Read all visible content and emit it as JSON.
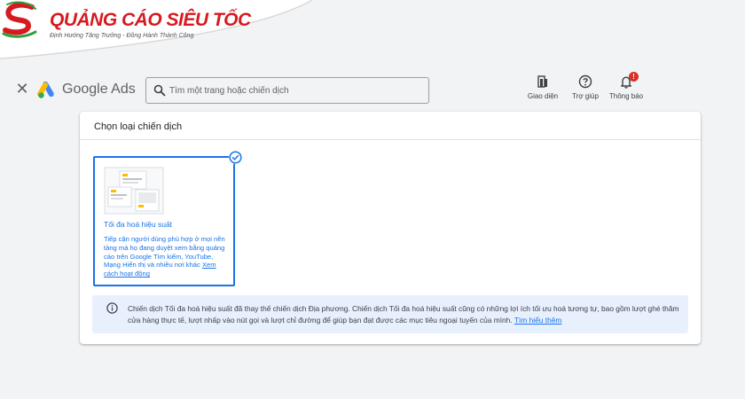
{
  "watermark": {
    "brand_name": "QUẢNG CÁO SIÊU TỐC",
    "tagline": "Định Hướng Tăng Trưởng - Đồng Hành Thành Công",
    "colors": {
      "red": "#d71920",
      "green": "#2e9e3e"
    }
  },
  "header": {
    "close_icon": "close-icon",
    "product_name": "Google Ads",
    "search": {
      "placeholder": "Tìm một trang hoặc chiến dịch"
    },
    "tools": [
      {
        "label": "Giao diện",
        "icon": "appearance-icon"
      },
      {
        "label": "Trợ giúp",
        "icon": "help-icon"
      },
      {
        "label": "Thông báo",
        "icon": "bell-icon",
        "badge": "!"
      }
    ]
  },
  "main": {
    "title": "Chọn loại chiến dịch",
    "campaign_option": {
      "title": "Tối đa hoá hiệu suất",
      "description": "Tiếp cận người dùng phù hợp ở mọi nền tảng mà họ đang duyệt xem bằng quảng cáo trên Google Tìm kiếm, YouTube, Mạng Hiển thị và nhiều nơi khác",
      "link": "Xem cách hoạt động",
      "selected": true
    },
    "info": {
      "text": "Chiến dịch Tối đa hoá hiệu suất đã thay thế chiến dịch Địa phương. Chiến dịch Tối đa hoá hiệu suất cũng có những lợi ích tối ưu hoá tương tự, bao gồm lượt ghé thăm cửa hàng thực tế, lượt nhấp vào nút gọi và lượt chỉ đường để giúp bạn đạt được các mục tiêu ngoại tuyến của mình.",
      "link": "Tìm hiểu thêm"
    }
  },
  "colors": {
    "accent": "#1a73e8",
    "info_bg": "#e8f0fe",
    "page_bg": "#f1f3f4"
  }
}
